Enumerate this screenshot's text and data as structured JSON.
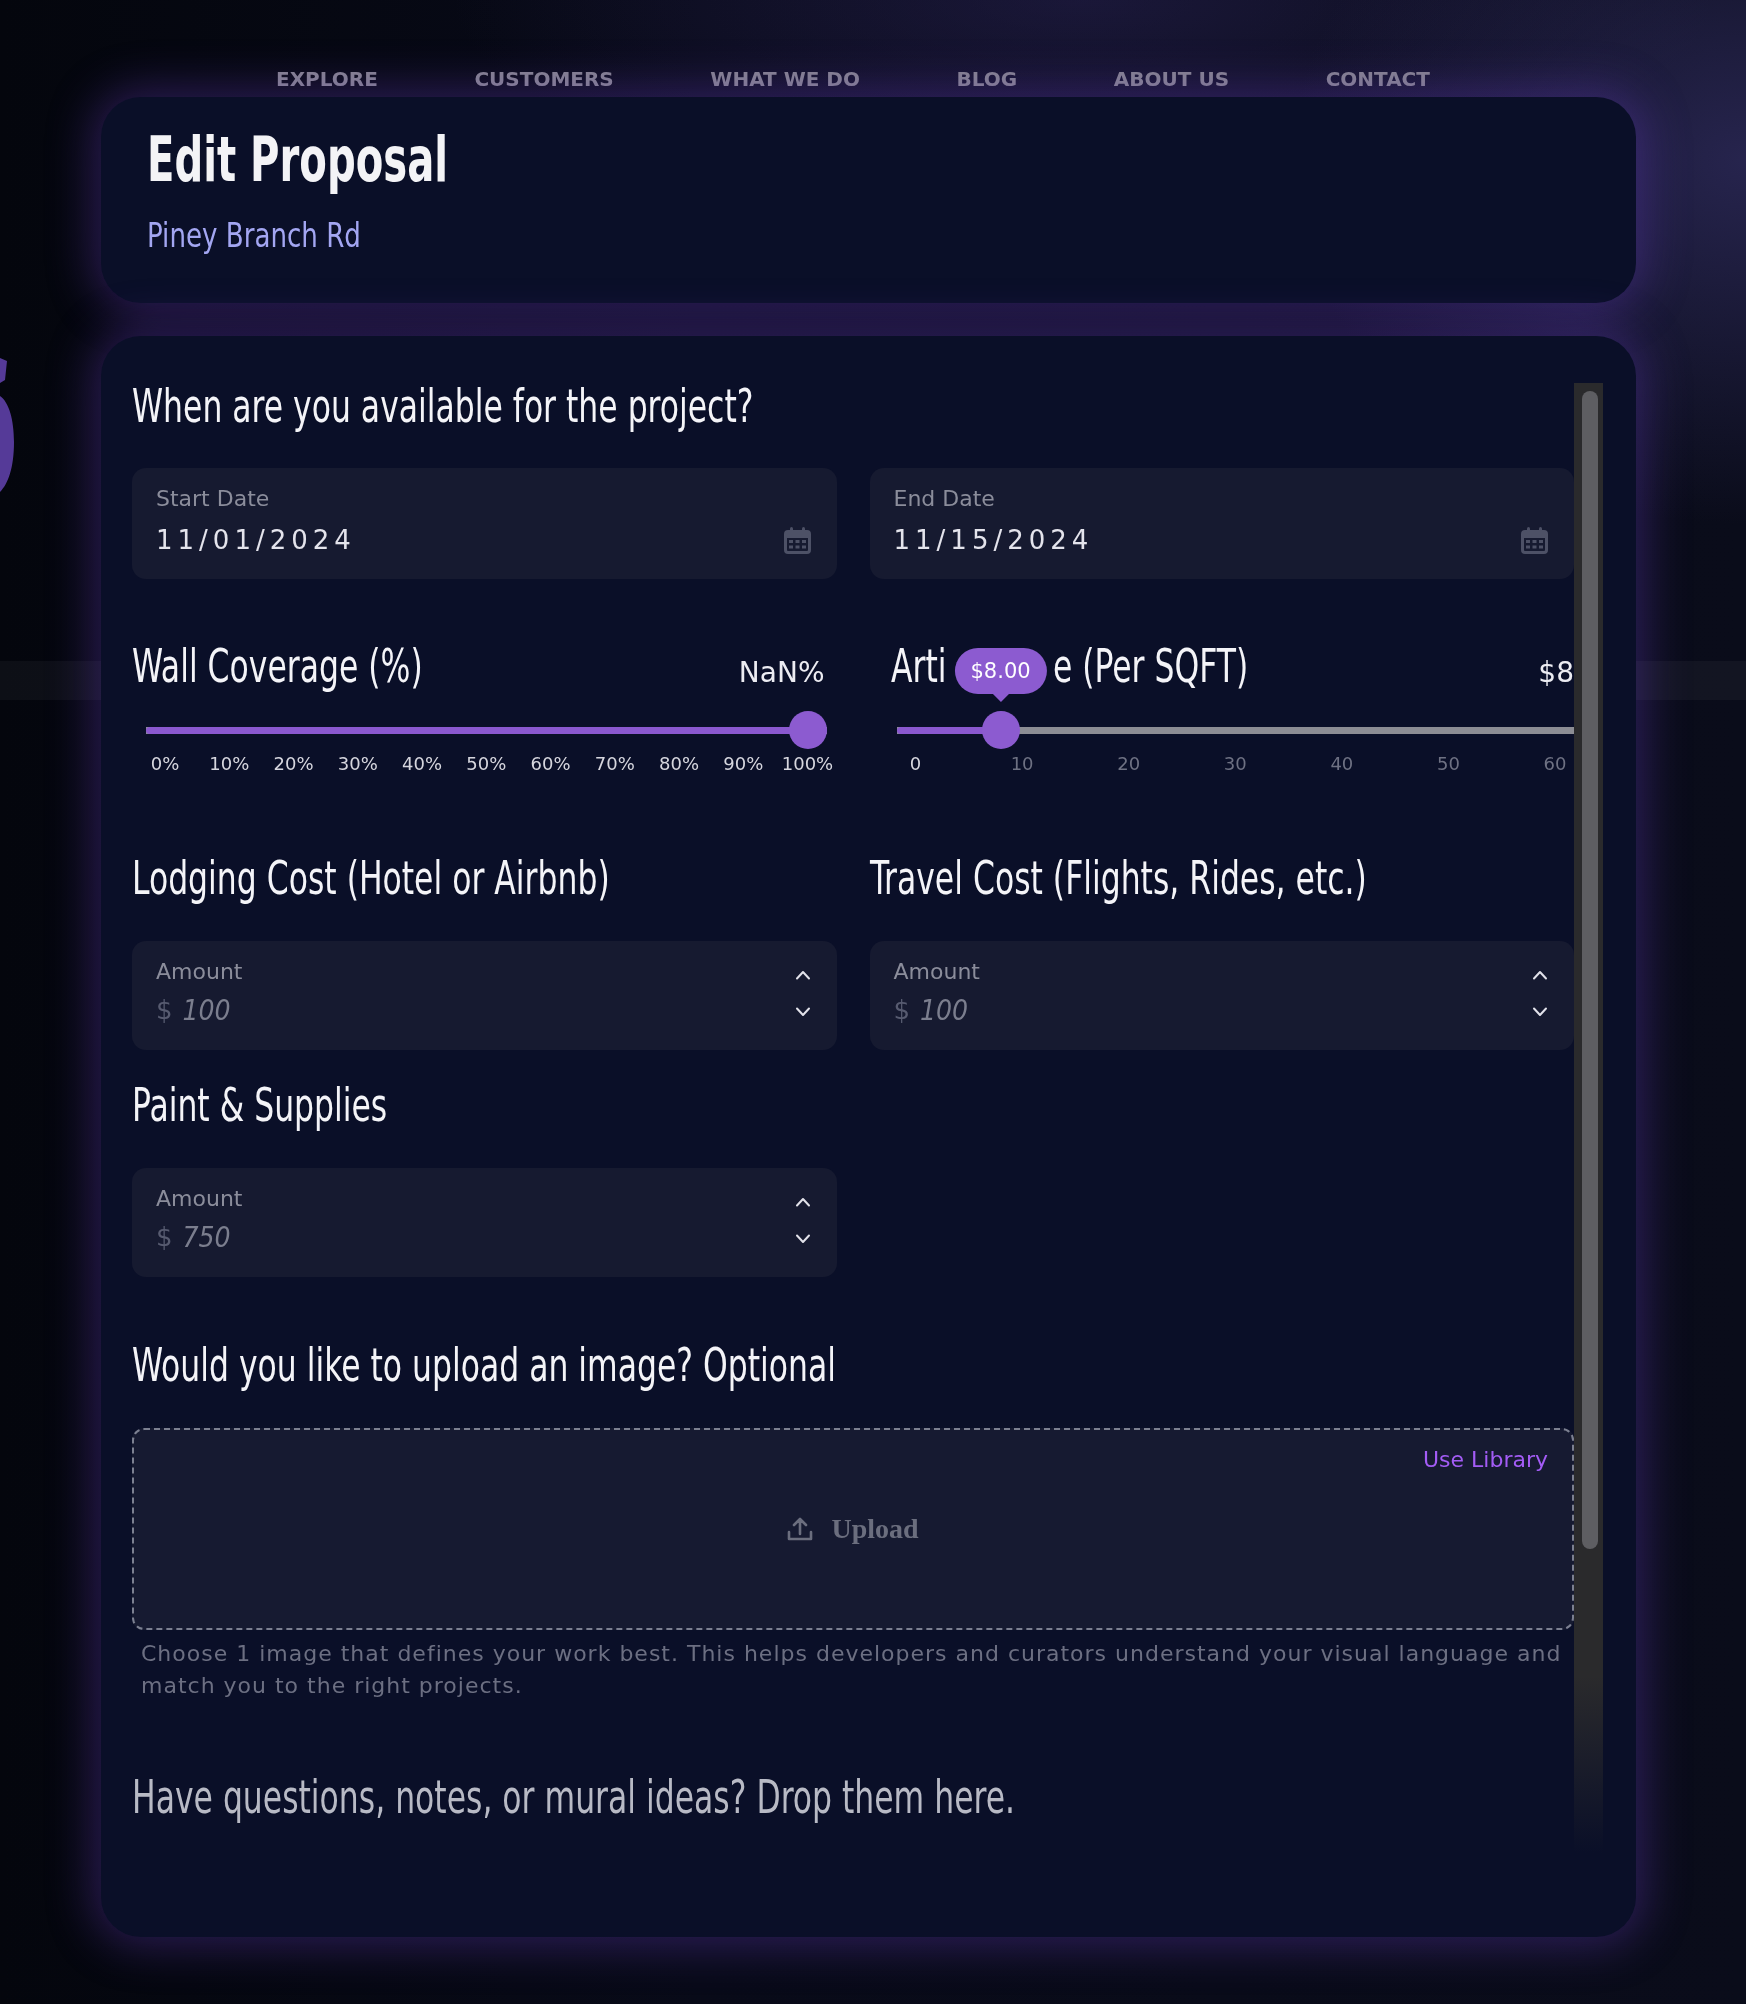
{
  "nav": [
    "EXPLORE",
    "CUSTOMERS",
    "WHAT WE DO",
    "BLOG",
    "ABOUT US",
    "CONTACT"
  ],
  "header": {
    "title": "Edit Proposal",
    "subtitle": "Piney Branch Rd"
  },
  "availability": {
    "heading": "When are you available for the project?",
    "fields": [
      {
        "label": "Start Date",
        "value": "11/01/2024"
      },
      {
        "label": "End Date",
        "value": "11/15/2024"
      }
    ]
  },
  "sliders": [
    {
      "heading_parts": [
        "Wall Coverage (%)"
      ],
      "reading": "NaN%",
      "level": 1,
      "ticks": [
        "0%",
        "10%",
        "20%",
        "30%",
        "40%",
        "50%",
        "60%",
        "70%",
        "80%",
        "90%",
        "100%"
      ]
    },
    {
      "heading_parts": [
        "Arti",
        "e (Per SQFT)"
      ],
      "reading": "$8",
      "tooltip": "$8.00",
      "level": 0.133,
      "ticks": [
        "0",
        "10",
        "20",
        "30",
        "40",
        "50",
        "60"
      ]
    }
  ],
  "costs": [
    {
      "heading": "Lodging Cost (Hotel or Airbnb)",
      "label": "Amount",
      "prefix": "$",
      "placeholder": "100"
    },
    {
      "heading": "Travel Cost (Flights, Rides, etc.)",
      "label": "Amount",
      "prefix": "$",
      "placeholder": "100"
    },
    {
      "heading": "Paint & Supplies",
      "label": "Amount",
      "prefix": "$",
      "placeholder": "750"
    }
  ],
  "upload": {
    "heading": "Would you like to upload an image? Optional",
    "link": "Use Library",
    "button": "Upload",
    "help": "Choose 1 image that defines your work best. This helps developers and curators understand your visual language and match you to the right projects."
  },
  "notes": {
    "heading": "Have questions, notes, or mural ideas? Drop them here."
  }
}
